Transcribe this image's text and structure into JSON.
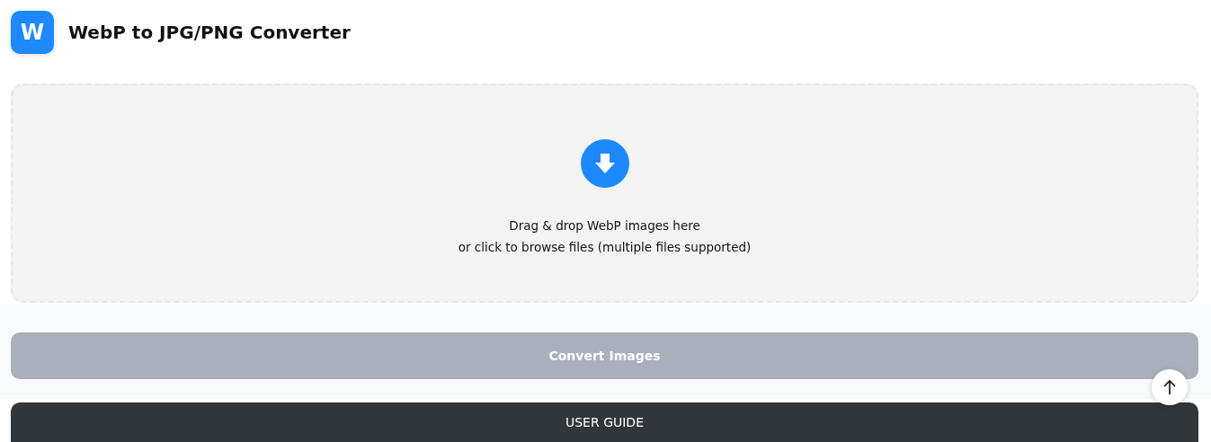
{
  "header": {
    "logo_letter": "W",
    "title": "WebP to JPG/PNG Converter"
  },
  "dropzone": {
    "lines": [
      "Drag & drop WebP images here",
      "or click to browse files (multiple files supported)"
    ]
  },
  "convert_button": {
    "label": "Convert Images",
    "disabled": true
  },
  "user_guide_button": {
    "label": "USER GUIDE"
  }
}
